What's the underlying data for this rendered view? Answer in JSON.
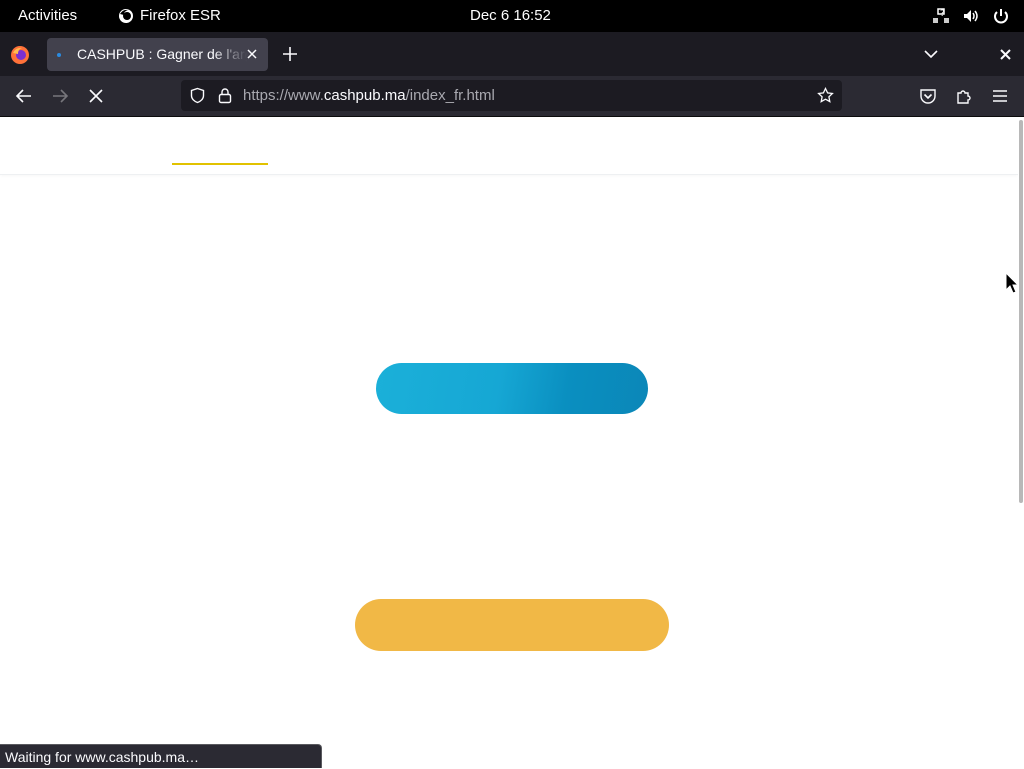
{
  "topbar": {
    "activities": "Activities",
    "app_name": "Firefox ESR",
    "clock": "Dec 6  16:52"
  },
  "browser": {
    "tab": {
      "title": "CASHPUB : Gagner de l'argent"
    },
    "url": {
      "prefix": "https://www.",
      "domain": "cashpub.ma",
      "path": "/index_fr.html"
    },
    "status": "Waiting for www.cashpub.ma…"
  },
  "page": {
    "nav_indicator_color": "#e1c200",
    "button_primary_color": "#0b87b8",
    "button_secondary_color": "#f1b846"
  }
}
